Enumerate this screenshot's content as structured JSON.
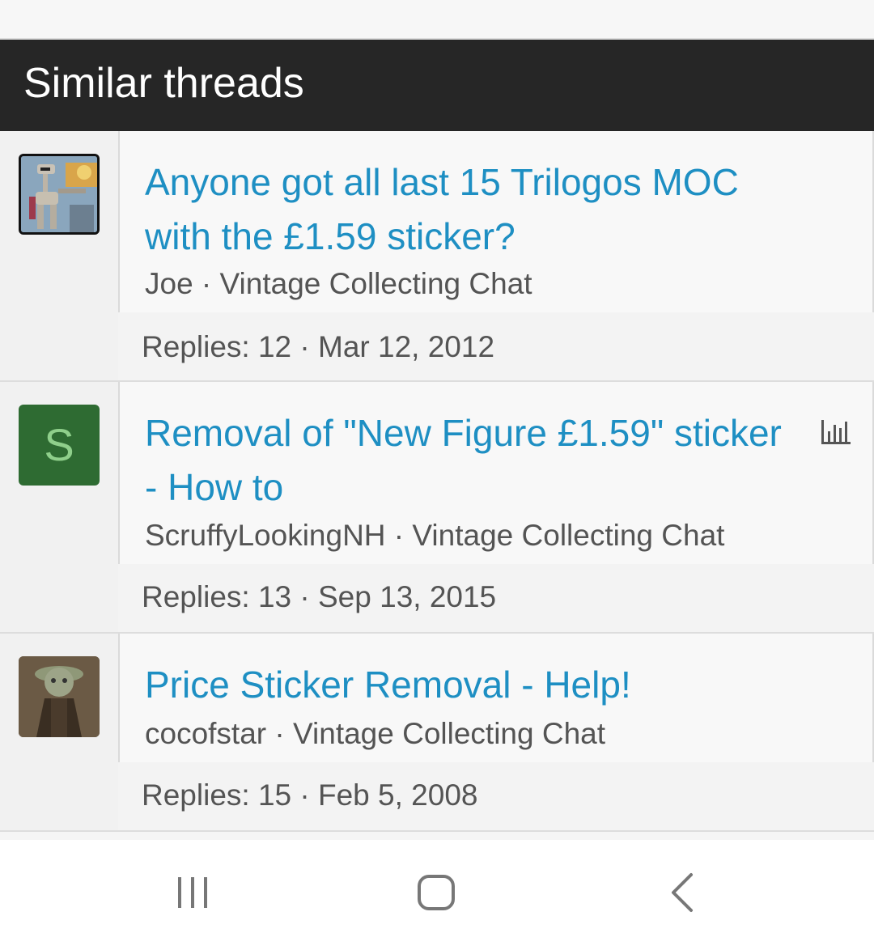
{
  "section": {
    "title": "Similar threads"
  },
  "threads": [
    {
      "title": "Anyone got all last 15 Trilogos MOC with the £1.59 sticker?",
      "author": "Joe",
      "forum": "Vintage Collecting Chat",
      "replies_label": "Replies: 12",
      "date": "Mar 12, 2012",
      "avatar": "droid-avatar-image"
    },
    {
      "title": "Removal of \"New Figure £1.59\" sticker - How to",
      "author": "ScruffyLookingNH",
      "forum": "Vintage Collecting Chat",
      "replies_label": "Replies: 13",
      "date": "Sep 13, 2015",
      "avatar_letter": "S",
      "avatar_color": "#2e6b32",
      "has_poll_icon": true
    },
    {
      "title": "Price Sticker Removal - Help!",
      "author": "cocofstar",
      "forum": "Vintage Collecting Chat",
      "replies_label": "Replies: 15",
      "date": "Feb 5, 2008",
      "avatar": "yoda-figure-avatar-image"
    }
  ],
  "separator": " · ",
  "colors": {
    "link": "#1e8fc3",
    "header_bg": "#262626",
    "meta_text": "#545454"
  },
  "system_nav": [
    "recent-apps-icon",
    "home-icon",
    "back-icon"
  ]
}
